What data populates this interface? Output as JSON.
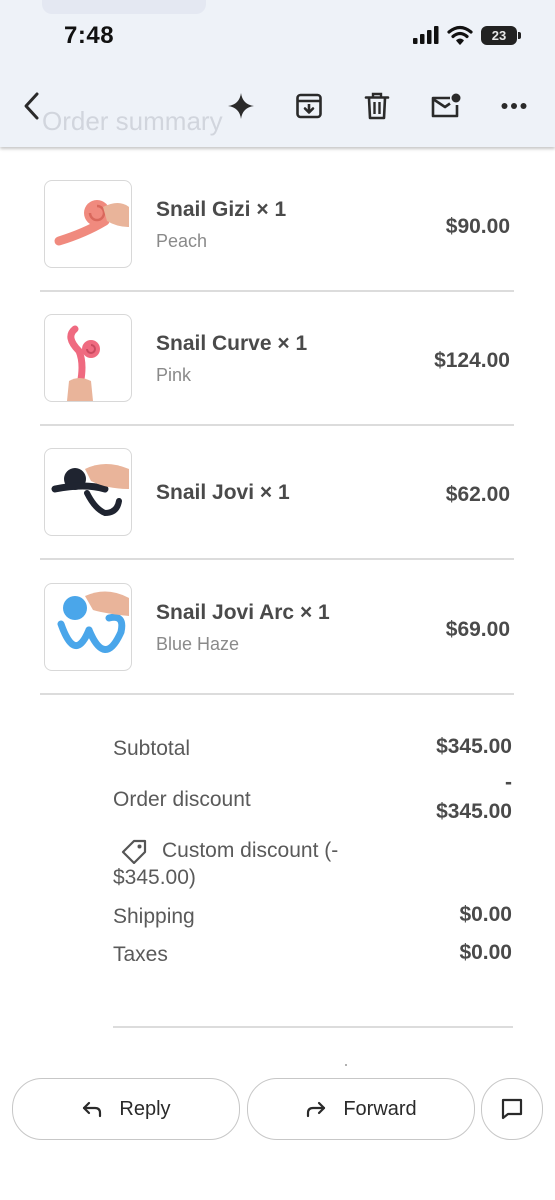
{
  "status_bar": {
    "time": "7:48",
    "battery": "23"
  },
  "header": {
    "title": "Order summary"
  },
  "toolbar": {
    "back_icon": "chevron-left-icon",
    "ai_icon": "sparkle-icon",
    "archive_icon": "archive-icon",
    "delete_icon": "trash-icon",
    "unread_icon": "mail-unread-icon",
    "more_icon": "more-horizontal-icon"
  },
  "items": [
    {
      "name": "Snail Gizi × 1",
      "variant": "Peach",
      "price": "$90.00",
      "color": "#f08a7e"
    },
    {
      "name": "Snail Curve × 1",
      "variant": "Pink",
      "price": "$124.00",
      "color": "#ef6a80"
    },
    {
      "name": "Snail Jovi × 1",
      "variant": "",
      "price": "$62.00",
      "color": "#1f2430"
    },
    {
      "name": "Snail Jovi Arc × 1",
      "variant": "Blue Haze",
      "price": "$69.00",
      "color": "#4aa6ea"
    }
  ],
  "summary": {
    "subtotal_label": "Subtotal",
    "subtotal_value": "$345.00",
    "discount_label": "Order discount",
    "discount_sign": "-",
    "discount_value": "$345.00",
    "custom_discount_line1": "Custom discount (-",
    "custom_discount_line2": "$345.00)",
    "shipping_label": "Shipping",
    "shipping_value": "$0.00",
    "taxes_label": "Taxes",
    "taxes_value": "$0.00"
  },
  "actions": {
    "reply": "Reply",
    "forward": "Forward"
  }
}
